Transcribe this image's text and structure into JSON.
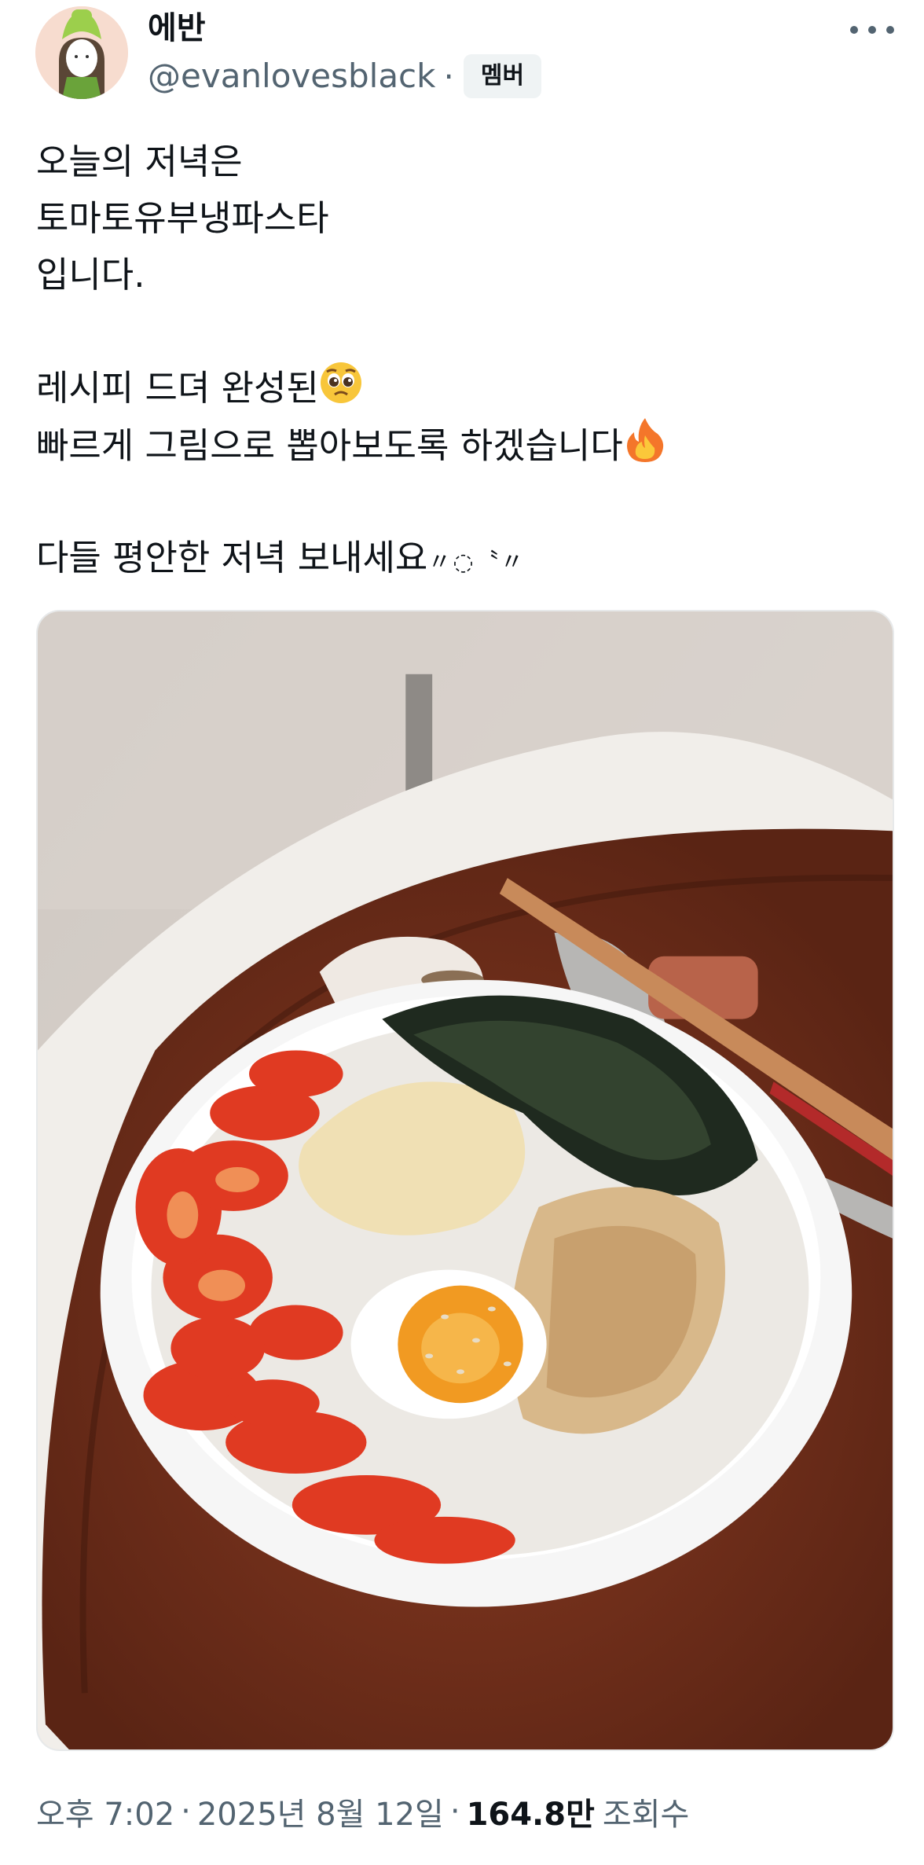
{
  "author": {
    "display_name": "에반",
    "handle": "@evanlovesblack",
    "separator": "·",
    "badge": "멤버"
  },
  "menu": {
    "icon": "more-horizontal-icon"
  },
  "tweet": {
    "lines": [
      "오늘의 저녁은",
      "토마토유부냉파스타",
      "입니다.",
      "",
      "레시피 드뎌 완성된",
      "빠르게 그림으로 뽑아보도록 하겠습니다",
      "",
      "다들 평안한 저녁 보내세요"
    ],
    "emoji_1": "pleading-face-emoji",
    "emoji_2": "fire-emoji",
    "kaomoji": "〃◌〝〃"
  },
  "media": {
    "icon": "food-photo-image"
  },
  "meta": {
    "time": "오후 7:02",
    "sep1": "·",
    "date": "2025년 8월 12일",
    "sep2": "·",
    "views_count": "164.8만",
    "views_label": "조회수"
  },
  "colors": {
    "text_primary": "#0f1419",
    "text_secondary": "#536471",
    "badge_bg": "#eff3f4",
    "border": "#e7e9ea"
  }
}
